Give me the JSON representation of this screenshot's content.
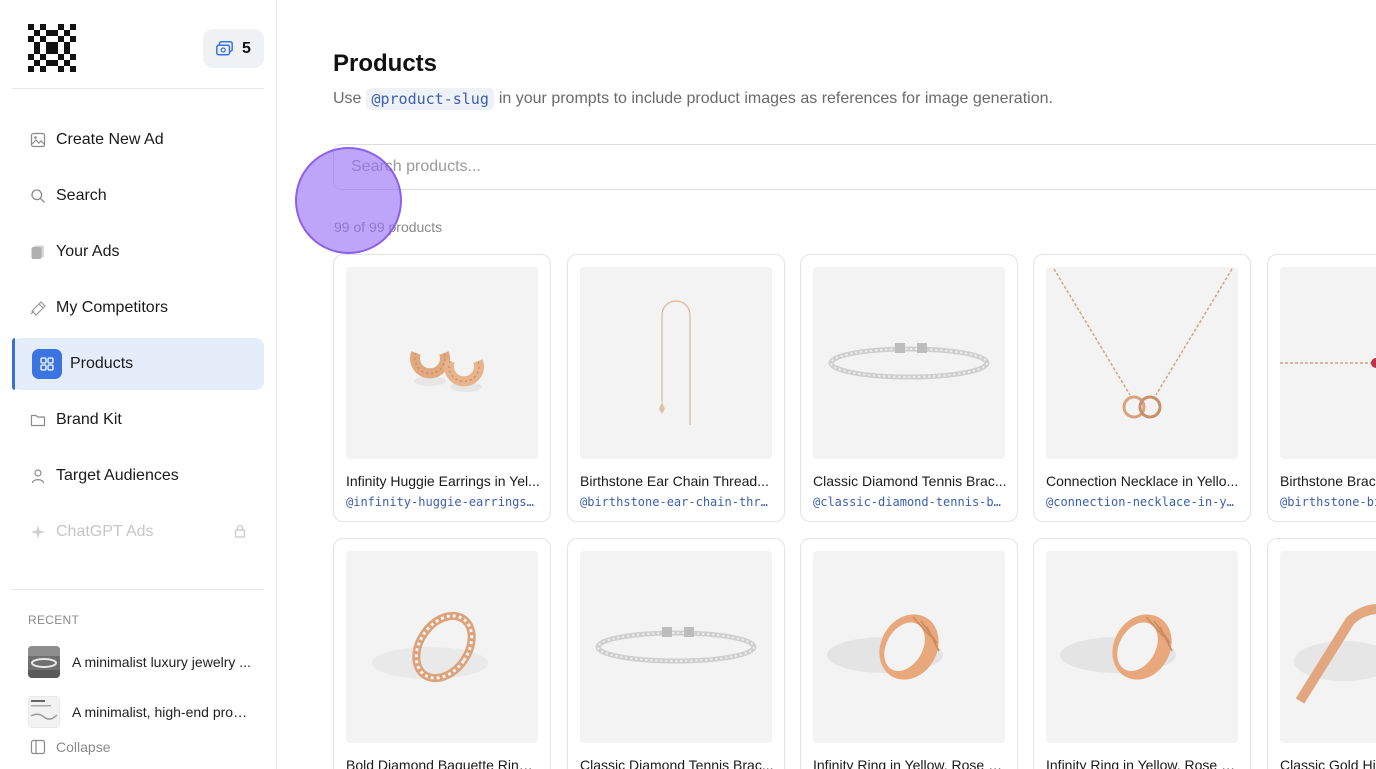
{
  "sidebar": {
    "credits": "5",
    "nav": [
      {
        "label": "Create New Ad",
        "icon": "image-icon"
      },
      {
        "label": "Search",
        "icon": "search-icon"
      },
      {
        "label": "Your Ads",
        "icon": "ads-icon"
      },
      {
        "label": "My Competitors",
        "icon": "competitors-icon"
      },
      {
        "label": "Products",
        "icon": "grid-icon",
        "active": true
      },
      {
        "label": "Brand Kit",
        "icon": "folder-icon"
      },
      {
        "label": "Target Audiences",
        "icon": "user-icon"
      },
      {
        "label": "ChatGPT Ads",
        "icon": "sparkle-icon",
        "disabled": true,
        "locked": true
      }
    ],
    "recent_label": "RECENT",
    "recent": [
      {
        "text": "A minimalist luxury jewelry ..."
      },
      {
        "text": "A minimalist, high-end prod..."
      }
    ],
    "collapse_label": "Collapse"
  },
  "main": {
    "title": "Products",
    "subtitle_prefix": "Use",
    "subtitle_slug": "@product-slug",
    "subtitle_suffix": "in your prompts to include product images as references for image generation.",
    "search_placeholder": "Search products...",
    "count_text": "99 of 99 products"
  },
  "products": [
    {
      "name": "Infinity Huggie Earrings in Yel...",
      "slug": "@infinity-huggie-earrings...",
      "kind": "earrings"
    },
    {
      "name": "Birthstone Ear Chain Thread...",
      "slug": "@birthstone-ear-chain-thr...",
      "kind": "ear-chain"
    },
    {
      "name": "Classic Diamond Tennis Brac...",
      "slug": "@classic-diamond-tennis-b...",
      "kind": "tennis"
    },
    {
      "name": "Connection Necklace in Yello...",
      "slug": "@connection-necklace-in-y...",
      "kind": "necklace"
    },
    {
      "name": "Birthstone Brac",
      "slug": "@birthstone-bi",
      "kind": "chain-bracelet"
    },
    {
      "name": "Bold Diamond Baguette Ring ...",
      "slug": "",
      "kind": "baguette-ring"
    },
    {
      "name": "Classic Diamond Tennis Brac...",
      "slug": "",
      "kind": "tennis"
    },
    {
      "name": "Infinity Ring in Yellow, Rose o...",
      "slug": "",
      "kind": "fluted-ring"
    },
    {
      "name": "Infinity Ring in Yellow, Rose o...",
      "slug": "",
      "kind": "fluted-ring"
    },
    {
      "name": "Classic Gold Hi",
      "slug": "",
      "kind": "bangle"
    }
  ],
  "colors": {
    "accent": "#3b73e0",
    "active_bg": "#e6edfa",
    "slug_text": "#3b5fb0",
    "gold": "#e0a77f",
    "silver": "#c9c9c9"
  }
}
